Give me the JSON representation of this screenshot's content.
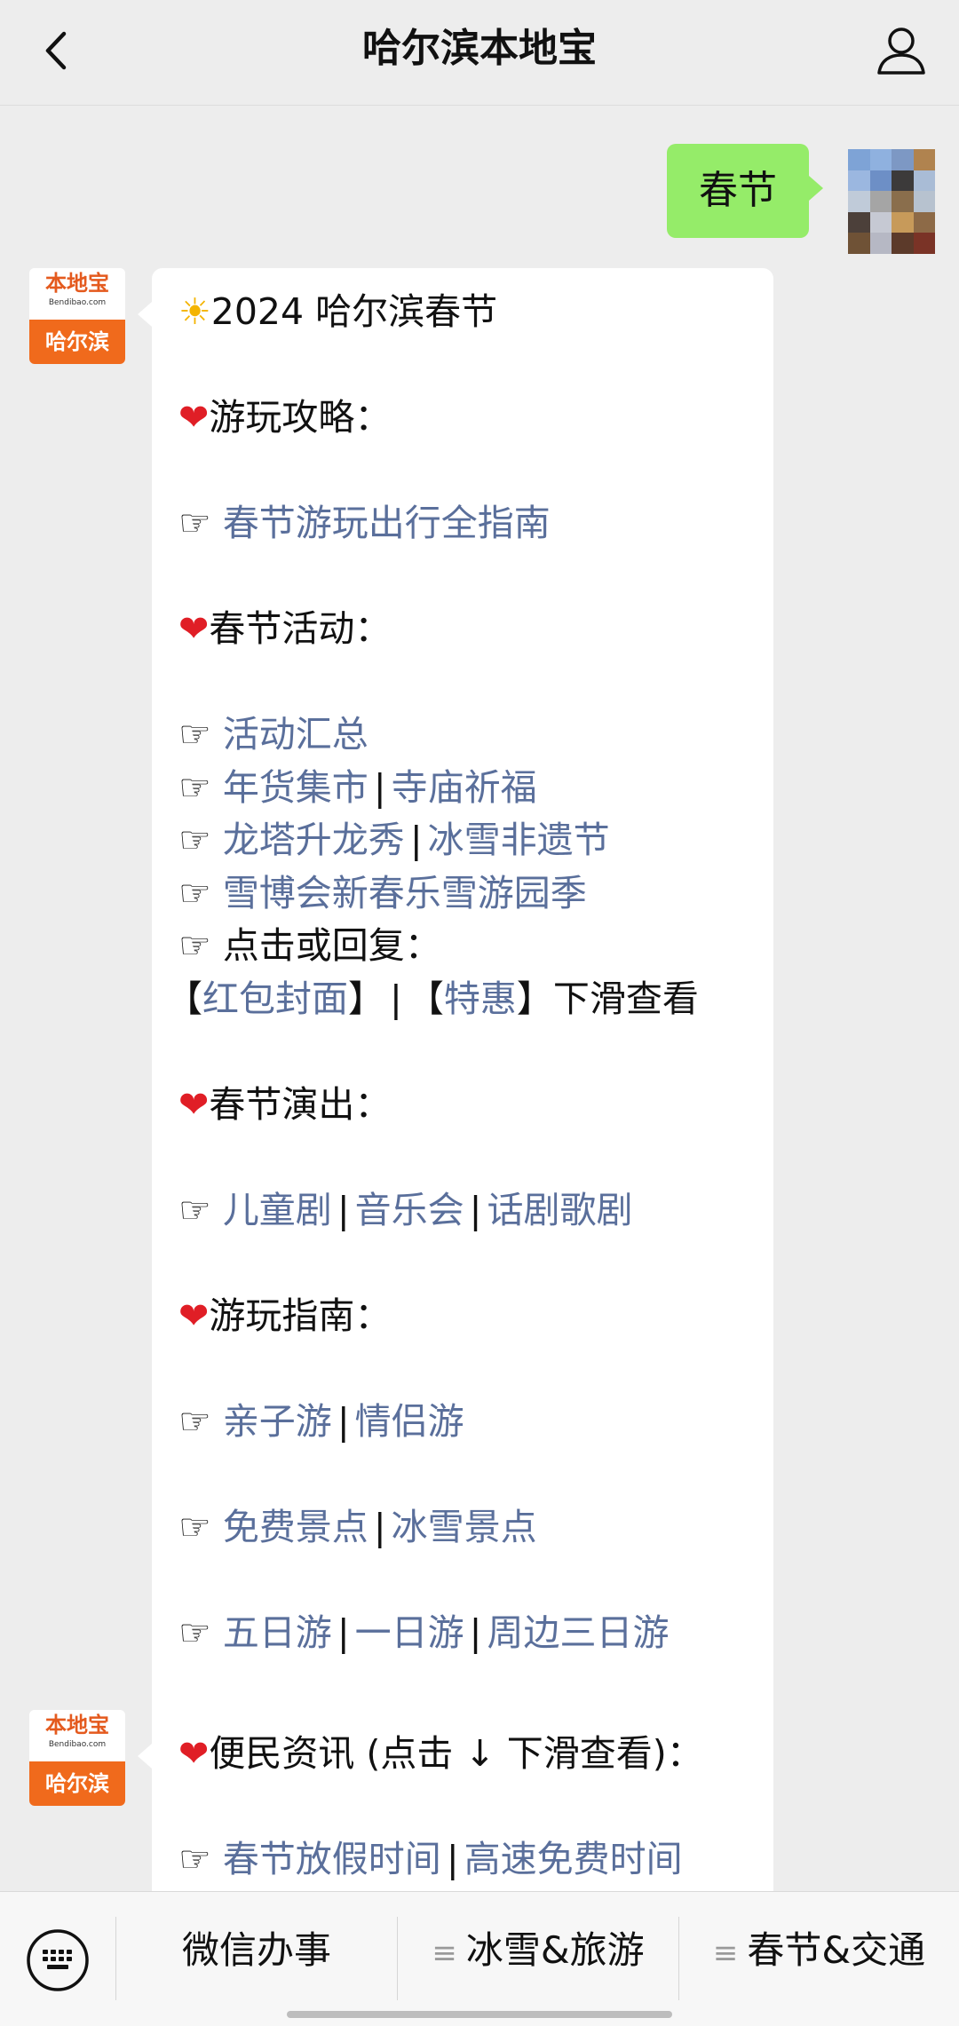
{
  "header": {
    "title": "哈尔滨本地宝"
  },
  "user_message": {
    "text": "春节"
  },
  "bot": {
    "avatar_top": "本地宝",
    "avatar_domain": "Bendibao.com",
    "avatar_city": "哈尔滨"
  },
  "message1": {
    "title": "2024 哈尔滨春节",
    "sec1_heading": "游玩攻略：",
    "sec1_link": "春节游玩出行全指南",
    "sec2_heading": "春节活动：",
    "sec2_link1": "活动汇总",
    "sec2_link2": "年货集市",
    "sec2_link3": "寺庙祈福",
    "sec2_link4": "龙塔升龙秀",
    "sec2_link5": "冰雪非遗节",
    "sec2_link6": "雪博会新春乐雪游园季",
    "sec2_reply": "点击或回复：",
    "sec2_kw1": "红包封面",
    "sec2_kw2": "特惠",
    "sec2_slide": "下滑查看",
    "sec3_heading": "春节演出：",
    "sec3_link1": "儿童剧",
    "sec3_link2": "音乐会",
    "sec3_link3": "话剧歌剧",
    "sec4_heading": "游玩指南：",
    "sec4_link1": "亲子游",
    "sec4_link2": "情侣游",
    "sec4_link3": "免费景点",
    "sec4_link4": "冰雪景点",
    "sec4_link5": "五日游",
    "sec4_link6": "一日游",
    "sec4_link7": "周边三日游"
  },
  "message2": {
    "heading": "便民资讯 (点击 ↓ 下滑查看)：",
    "link1": "春节放假时间",
    "link2": "高速免费时间"
  },
  "bottom_menu": {
    "item1": "微信办事",
    "item2": "冰雪&旅游",
    "item3": "春节&交通"
  },
  "symbols": {
    "hand": "☞",
    "heart": "❤",
    "sun": "☀",
    "sep": "|",
    "menu_lines": "≡",
    "lb": "【",
    "rb": "】"
  },
  "colors": {
    "link": "#5a6f9b",
    "user_bubble": "#95ec69",
    "heart": "#e01e26",
    "brand": "#f06a1c"
  }
}
